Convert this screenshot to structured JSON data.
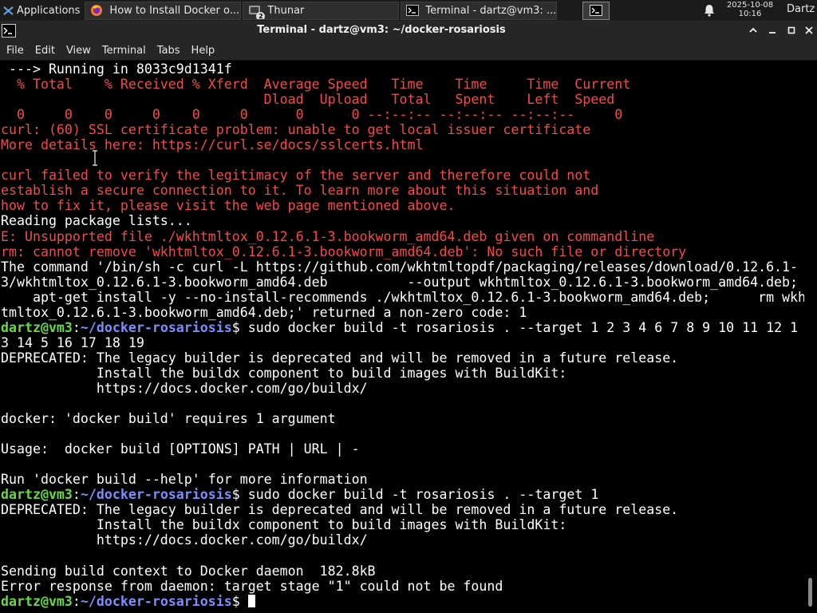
{
  "taskbar": {
    "applications_label": "Applications",
    "tasks": [
      {
        "label": "How to Install Docker o...",
        "icon": "firefox-icon"
      },
      {
        "label": "Thunar",
        "icon": "file-manager-icon",
        "badge": "2"
      },
      {
        "label": "Terminal - dartz@vm3: ...",
        "icon": "terminal-icon"
      }
    ],
    "clock": {
      "date": "2025-10-08",
      "time": "10:16"
    },
    "user": "Dartz"
  },
  "window": {
    "title": "Terminal - dartz@vm3: ~/docker-rosariosis",
    "menu": [
      "File",
      "Edit",
      "View",
      "Terminal",
      "Tabs",
      "Help"
    ]
  },
  "terminal": {
    "prompt_user": "dartz@vm3",
    "prompt_path": "~/docker-rosariosis",
    "prompt_sep": ":",
    "prompt_end": "$",
    "lines": [
      " ---> Running in 8033c9d1341f",
      "  % Total    % Received % Xferd  Average Speed   Time    Time     Time  Current",
      "                                 Dload  Upload   Total   Spent    Left  Speed",
      "  0     0    0     0    0     0      0      0 --:--:-- --:--:-- --:--:--     0",
      "curl: (60) SSL certificate problem: unable to get local issuer certificate",
      "More details here: https://curl.se/docs/sslcerts.html",
      "",
      "curl failed to verify the legitimacy of the server and therefore could not",
      "establish a secure connection to it. To learn more about this situation and",
      "how to fix it, please visit the web page mentioned above.",
      "Reading package lists...",
      "E: Unsupported file ./wkhtmltox_0.12.6.1-3.bookworm_amd64.deb given on commandline",
      "rm: cannot remove 'wkhtmltox_0.12.6.1-3.bookworm_amd64.deb': No such file or directory",
      "The command '/bin/sh -c curl -L https://github.com/wkhtmltopdf/packaging/releases/download/0.12.6.1-",
      "3/wkhtmltox_0.12.6.1-3.bookworm_amd64.deb          --output wkhtmltox_0.12.6.1-3.bookworm_amd64.deb;",
      "    apt-get install -y --no-install-recommends ./wkhtmltox_0.12.6.1-3.bookworm_amd64.deb;      rm wkh",
      "tmltox_0.12.6.1-3.bookworm_amd64.deb;' returned a non-zero code: 1",
      " sudo docker build -t rosariosis . --target 1 2 3 4 6 7 8 9 10 11 12 1",
      "3 14 5 16 17 18 19",
      "DEPRECATED: The legacy builder is deprecated and will be removed in a future release.",
      "            Install the buildx component to build images with BuildKit:",
      "            https://docs.docker.com/go/buildx/",
      "",
      "docker: 'docker build' requires 1 argument",
      "",
      "Usage:  docker build [OPTIONS] PATH | URL | -",
      "",
      "Run 'docker build --help' for more information",
      " sudo docker build -t rosariosis . --target 1",
      "DEPRECATED: The legacy builder is deprecated and will be removed in a future release.",
      "            Install the buildx component to build images with BuildKit:",
      "            https://docs.docker.com/go/buildx/",
      "",
      "Sending build context to Docker daemon  182.8kB",
      "Error response from daemon: target stage \"1\" could not be found",
      " "
    ],
    "red_line_indices": [
      1,
      2,
      3,
      4,
      5,
      7,
      8,
      9,
      11,
      12
    ],
    "prompt_line_indices": [
      17,
      28,
      35
    ],
    "cursor_line_index": 35
  }
}
